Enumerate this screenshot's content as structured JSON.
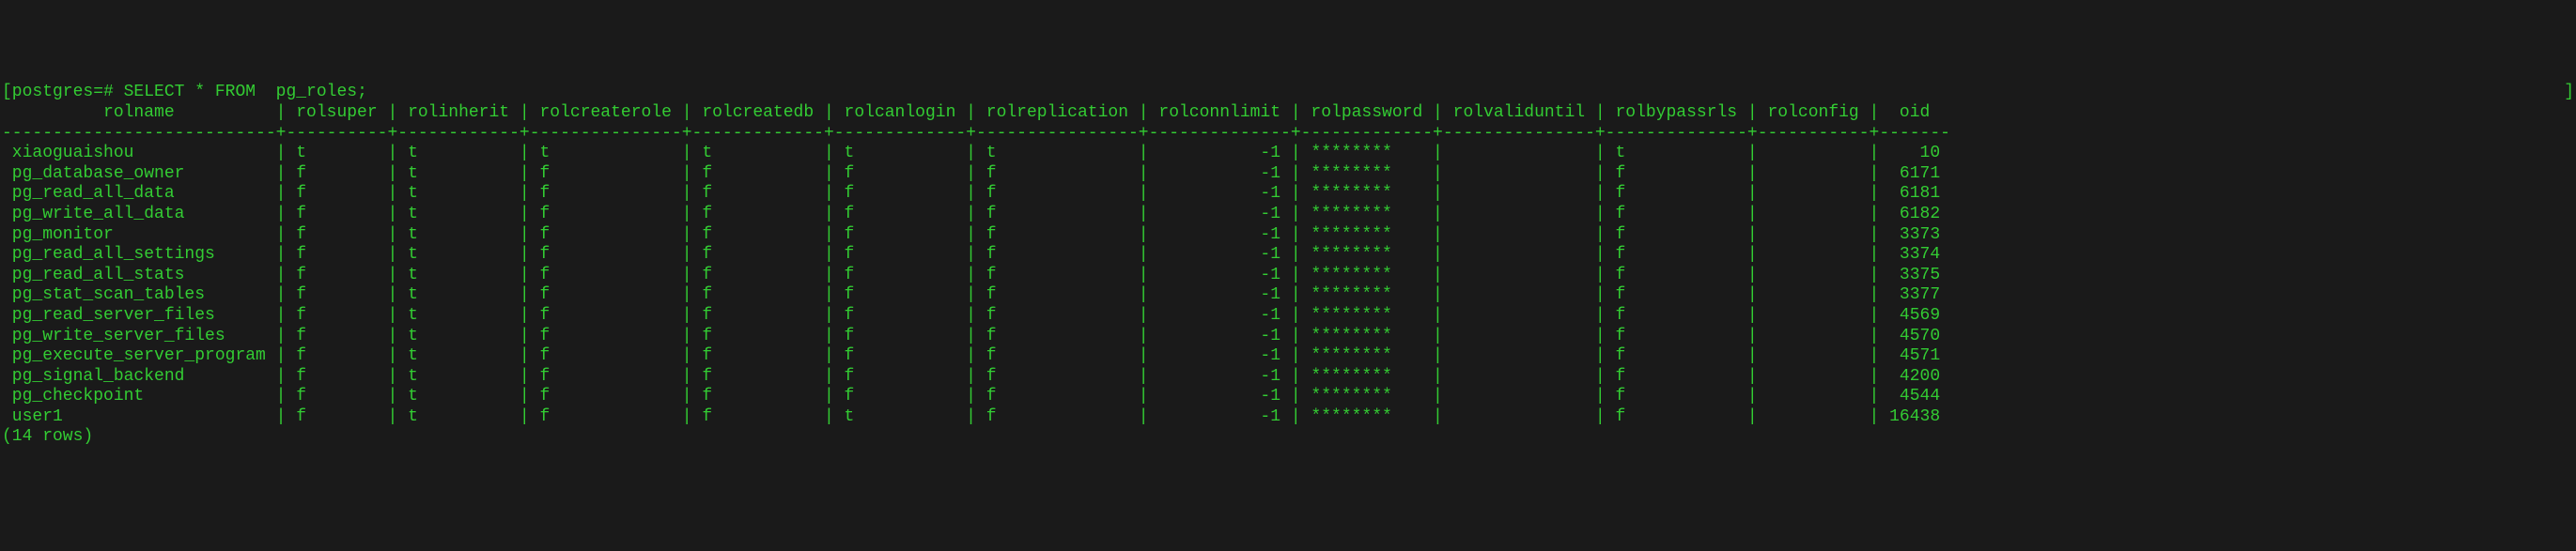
{
  "prompt": "[postgres=# ",
  "query": "SELECT * FROM  pg_roles;",
  "headers": {
    "rolname": "rolname",
    "rolsuper": "rolsuper",
    "rolinherit": "rolinherit",
    "rolcreaterole": "rolcreaterole",
    "rolcreatedb": "rolcreatedb",
    "rolcanlogin": "rolcanlogin",
    "rolreplication": "rolreplication",
    "rolconnlimit": "rolconnlimit",
    "rolpassword": "rolpassword",
    "rolvaliduntil": "rolvaliduntil",
    "rolbypassrls": "rolbypassrls",
    "rolconfig": "rolconfig",
    "oid": "oid"
  },
  "rows": [
    {
      "rolname": "xiaoguaishou",
      "rolsuper": "t",
      "rolinherit": "t",
      "rolcreaterole": "t",
      "rolcreatedb": "t",
      "rolcanlogin": "t",
      "rolreplication": "t",
      "rolconnlimit": "-1",
      "rolpassword": "********",
      "rolvaliduntil": "",
      "rolbypassrls": "t",
      "rolconfig": "",
      "oid": "10"
    },
    {
      "rolname": "pg_database_owner",
      "rolsuper": "f",
      "rolinherit": "t",
      "rolcreaterole": "f",
      "rolcreatedb": "f",
      "rolcanlogin": "f",
      "rolreplication": "f",
      "rolconnlimit": "-1",
      "rolpassword": "********",
      "rolvaliduntil": "",
      "rolbypassrls": "f",
      "rolconfig": "",
      "oid": "6171"
    },
    {
      "rolname": "pg_read_all_data",
      "rolsuper": "f",
      "rolinherit": "t",
      "rolcreaterole": "f",
      "rolcreatedb": "f",
      "rolcanlogin": "f",
      "rolreplication": "f",
      "rolconnlimit": "-1",
      "rolpassword": "********",
      "rolvaliduntil": "",
      "rolbypassrls": "f",
      "rolconfig": "",
      "oid": "6181"
    },
    {
      "rolname": "pg_write_all_data",
      "rolsuper": "f",
      "rolinherit": "t",
      "rolcreaterole": "f",
      "rolcreatedb": "f",
      "rolcanlogin": "f",
      "rolreplication": "f",
      "rolconnlimit": "-1",
      "rolpassword": "********",
      "rolvaliduntil": "",
      "rolbypassrls": "f",
      "rolconfig": "",
      "oid": "6182"
    },
    {
      "rolname": "pg_monitor",
      "rolsuper": "f",
      "rolinherit": "t",
      "rolcreaterole": "f",
      "rolcreatedb": "f",
      "rolcanlogin": "f",
      "rolreplication": "f",
      "rolconnlimit": "-1",
      "rolpassword": "********",
      "rolvaliduntil": "",
      "rolbypassrls": "f",
      "rolconfig": "",
      "oid": "3373"
    },
    {
      "rolname": "pg_read_all_settings",
      "rolsuper": "f",
      "rolinherit": "t",
      "rolcreaterole": "f",
      "rolcreatedb": "f",
      "rolcanlogin": "f",
      "rolreplication": "f",
      "rolconnlimit": "-1",
      "rolpassword": "********",
      "rolvaliduntil": "",
      "rolbypassrls": "f",
      "rolconfig": "",
      "oid": "3374"
    },
    {
      "rolname": "pg_read_all_stats",
      "rolsuper": "f",
      "rolinherit": "t",
      "rolcreaterole": "f",
      "rolcreatedb": "f",
      "rolcanlogin": "f",
      "rolreplication": "f",
      "rolconnlimit": "-1",
      "rolpassword": "********",
      "rolvaliduntil": "",
      "rolbypassrls": "f",
      "rolconfig": "",
      "oid": "3375"
    },
    {
      "rolname": "pg_stat_scan_tables",
      "rolsuper": "f",
      "rolinherit": "t",
      "rolcreaterole": "f",
      "rolcreatedb": "f",
      "rolcanlogin": "f",
      "rolreplication": "f",
      "rolconnlimit": "-1",
      "rolpassword": "********",
      "rolvaliduntil": "",
      "rolbypassrls": "f",
      "rolconfig": "",
      "oid": "3377"
    },
    {
      "rolname": "pg_read_server_files",
      "rolsuper": "f",
      "rolinherit": "t",
      "rolcreaterole": "f",
      "rolcreatedb": "f",
      "rolcanlogin": "f",
      "rolreplication": "f",
      "rolconnlimit": "-1",
      "rolpassword": "********",
      "rolvaliduntil": "",
      "rolbypassrls": "f",
      "rolconfig": "",
      "oid": "4569"
    },
    {
      "rolname": "pg_write_server_files",
      "rolsuper": "f",
      "rolinherit": "t",
      "rolcreaterole": "f",
      "rolcreatedb": "f",
      "rolcanlogin": "f",
      "rolreplication": "f",
      "rolconnlimit": "-1",
      "rolpassword": "********",
      "rolvaliduntil": "",
      "rolbypassrls": "f",
      "rolconfig": "",
      "oid": "4570"
    },
    {
      "rolname": "pg_execute_server_program",
      "rolsuper": "f",
      "rolinherit": "t",
      "rolcreaterole": "f",
      "rolcreatedb": "f",
      "rolcanlogin": "f",
      "rolreplication": "f",
      "rolconnlimit": "-1",
      "rolpassword": "********",
      "rolvaliduntil": "",
      "rolbypassrls": "f",
      "rolconfig": "",
      "oid": "4571"
    },
    {
      "rolname": "pg_signal_backend",
      "rolsuper": "f",
      "rolinherit": "t",
      "rolcreaterole": "f",
      "rolcreatedb": "f",
      "rolcanlogin": "f",
      "rolreplication": "f",
      "rolconnlimit": "-1",
      "rolpassword": "********",
      "rolvaliduntil": "",
      "rolbypassrls": "f",
      "rolconfig": "",
      "oid": "4200"
    },
    {
      "rolname": "pg_checkpoint",
      "rolsuper": "f",
      "rolinherit": "t",
      "rolcreaterole": "f",
      "rolcreatedb": "f",
      "rolcanlogin": "f",
      "rolreplication": "f",
      "rolconnlimit": "-1",
      "rolpassword": "********",
      "rolvaliduntil": "",
      "rolbypassrls": "f",
      "rolconfig": "",
      "oid": "4544"
    },
    {
      "rolname": "user1",
      "rolsuper": "f",
      "rolinherit": "t",
      "rolcreaterole": "f",
      "rolcreatedb": "f",
      "rolcanlogin": "t",
      "rolreplication": "f",
      "rolconnlimit": "-1",
      "rolpassword": "********",
      "rolvaliduntil": "",
      "rolbypassrls": "f",
      "rolconfig": "",
      "oid": "16438"
    }
  ],
  "footer": "(14 rows)",
  "cursor_end": "]"
}
